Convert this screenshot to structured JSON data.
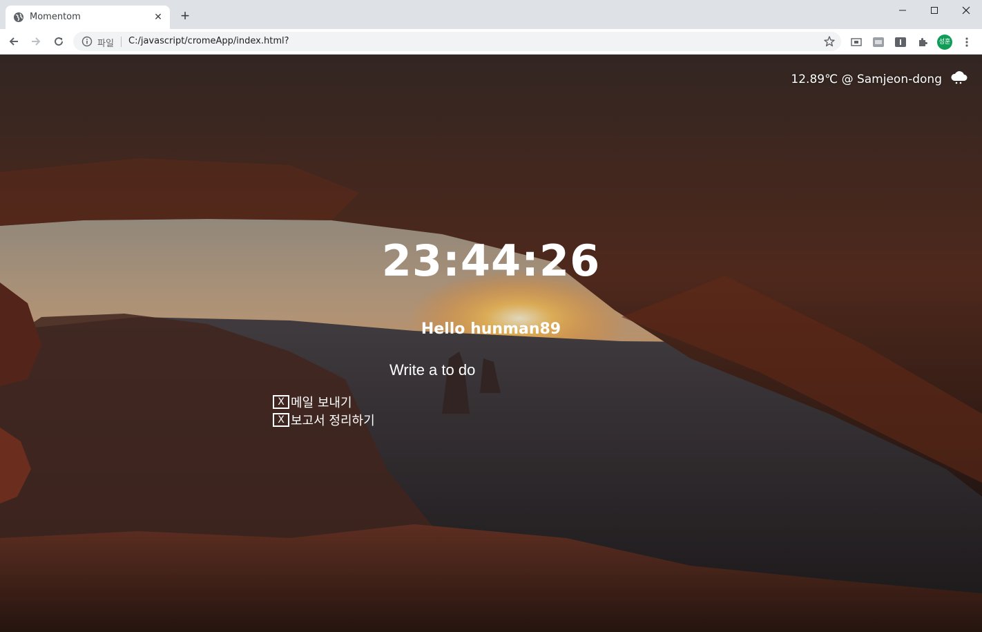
{
  "browser": {
    "tab_title": "Momentom",
    "tab_close": "✕",
    "new_tab": "+",
    "scheme_label": "파일",
    "url": "C:/javascript/cromeApp/index.html?",
    "profile_initials": "성훈"
  },
  "weather": {
    "text": "12.89℃ @ Samjeon-dong",
    "icon": "cloud-icon"
  },
  "clock": {
    "time": "23:44:26"
  },
  "greeting": {
    "text": "Hello hunman89"
  },
  "todo": {
    "placeholder": "Write a to do",
    "delete_label": "X",
    "items": [
      {
        "text": "메일 보내기"
      },
      {
        "text": "보고서 정리하기"
      }
    ]
  },
  "colors": {
    "accent": "#0f9d58",
    "tabstrip": "#dee1e6",
    "text_on_image": "#ffffff"
  }
}
